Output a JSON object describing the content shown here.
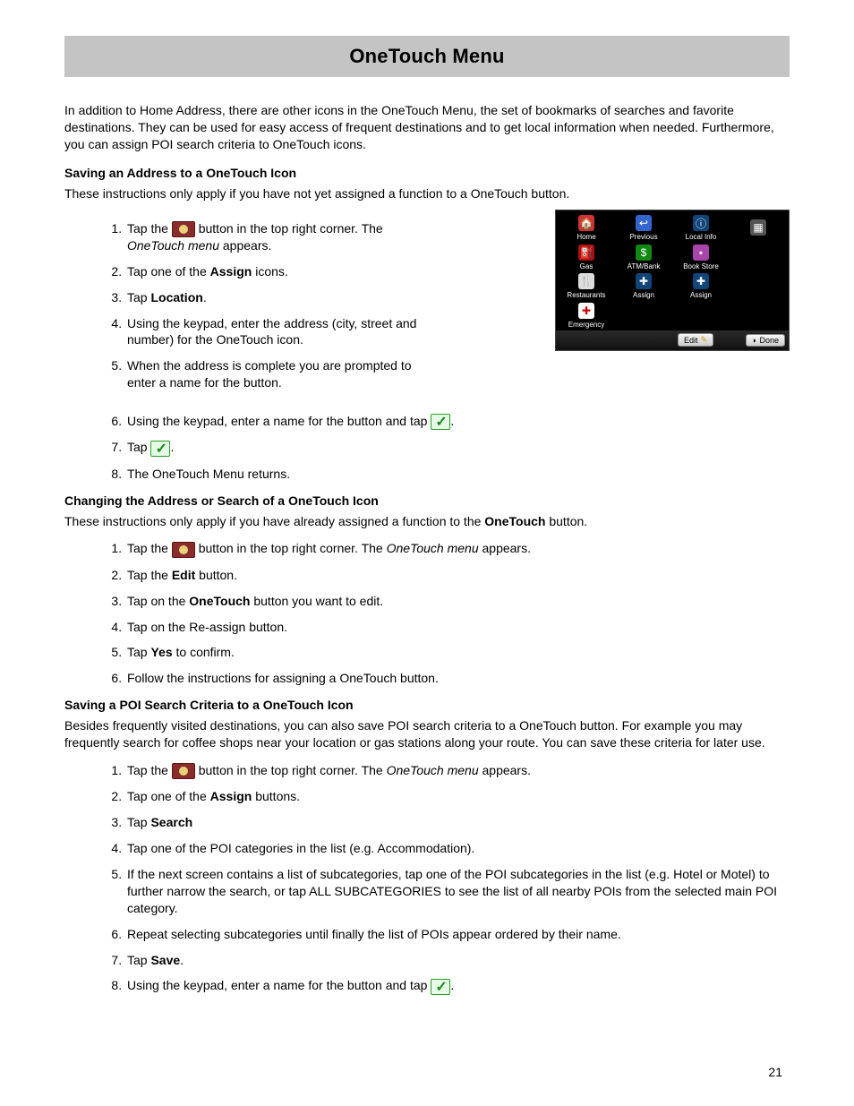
{
  "title": "OneTouch Menu",
  "intro": "In addition to Home Address, there are other icons in the OneTouch Menu, the set of bookmarks of searches and favorite destinations. They can be used for easy access of frequent destinations and to get local information when needed. Furthermore, you can assign POI search criteria to OneTouch icons.",
  "sec1": {
    "heading": "Saving an Address to a OneTouch Icon",
    "para": "These instructions only apply if you have not yet assigned a function to a OneTouch button.",
    "s1a": "Tap the ",
    "s1b": " button in the top right corner. The ",
    "s1c": "OneTouch menu",
    "s1d": " appears.",
    "s2a": "Tap one of the ",
    "s2b": "Assign",
    "s2c": " icons.",
    "s3a": "Tap ",
    "s3b": "Location",
    "s3c": ".",
    "s4": "Using the keypad, enter the address (city, street and number) for the OneTouch icon.",
    "s5": "When the address is complete you are prompted to enter a name for the button.",
    "s6a": "Using the keypad, enter a name for the button and tap ",
    "s6b": ".",
    "s7a": "Tap ",
    "s7b": ".",
    "s8": "The OneTouch Menu returns."
  },
  "sec2": {
    "heading": "Changing the Address or Search of a OneTouch Icon",
    "p1": "These instructions only apply if you have already assigned a function to the ",
    "p1b": "OneTouch",
    "p1c": " button.",
    "s1a": "Tap the ",
    "s1b": " button in the top right corner. The ",
    "s1c": "OneTouch menu",
    "s1d": " appears.",
    "s2a": "Tap the ",
    "s2b": "Edit",
    "s2c": " button.",
    "s3a": "Tap on the ",
    "s3b": "OneTouch",
    "s3c": " button you want to edit.",
    "s4": "Tap on the Re-assign button.",
    "s5a": "Tap ",
    "s5b": "Yes",
    "s5c": " to confirm.",
    "s6": "Follow the instructions for assigning a OneTouch button."
  },
  "sec3": {
    "heading": "Saving a POI Search Criteria to a OneTouch Icon",
    "para": "Besides frequently visited destinations, you can also save POI search criteria to a OneTouch button. For example you may frequently search for coffee shops near your location or gas stations along your route. You can save these criteria for later use.",
    "s1a": "Tap the ",
    "s1b": " button in the top right corner. The ",
    "s1c": "OneTouch menu",
    "s1d": " appears.",
    "s2a": "Tap one of the ",
    "s2b": "Assign",
    "s2c": " buttons.",
    "s3a": "Tap ",
    "s3b": "Search",
    "s4": "Tap one of the POI categories in the list (e.g. Accommodation).",
    "s5": "If the next screen contains a list of subcategories, tap one of the POI subcategories in the list (e.g. Hotel or Motel) to further narrow the search, or tap ALL SUBCATEGORIES to see the list of all nearby POIs from the selected main POI category.",
    "s6": "Repeat selecting subcategories until finally the list of POIs appear ordered by their name.",
    "s7a": "Tap ",
    "s7b": "Save",
    "s7c": ".",
    "s8a": "Using the keypad, enter a name for the button and tap ",
    "s8b": "."
  },
  "device": {
    "cells": [
      "Home",
      "Previous",
      "Local Info",
      "",
      "Gas",
      "ATM/Bank",
      "Book Store",
      "",
      "Restaurants",
      "Assign",
      "Assign",
      "",
      "Emergency",
      "",
      "",
      ""
    ],
    "edit": "Edit",
    "done": "Done"
  },
  "page_number": "21"
}
